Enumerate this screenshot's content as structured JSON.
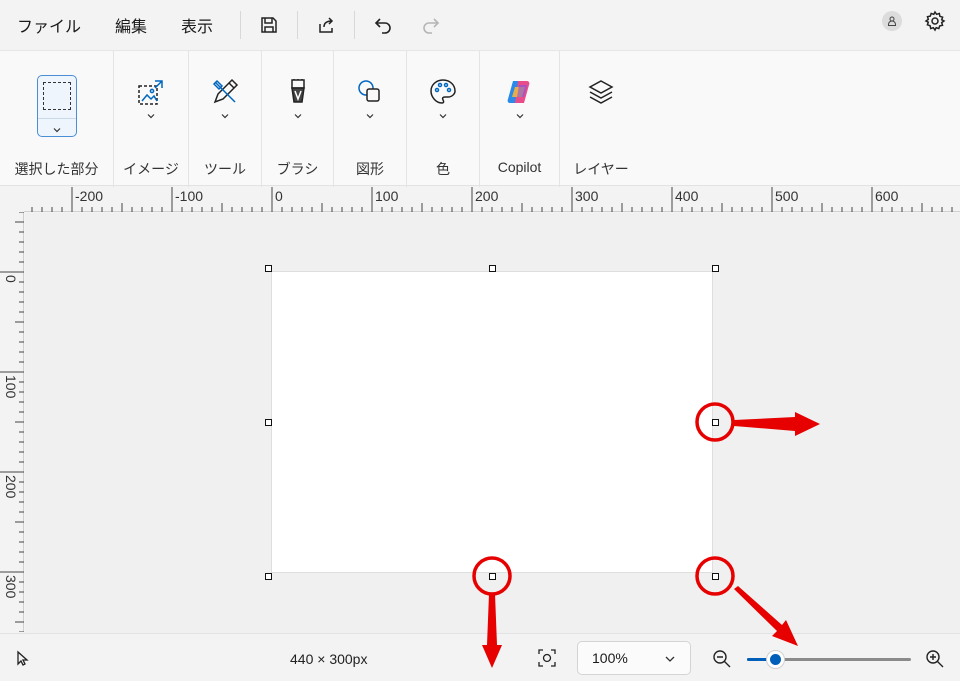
{
  "menu": {
    "file": "ファイル",
    "edit": "編集",
    "view": "表示"
  },
  "toolbar": {
    "save": "save-icon",
    "share": "share-icon",
    "undo": "undo-icon",
    "redo": "redo-icon"
  },
  "ribbon": {
    "groups": [
      {
        "label": "選択した部分",
        "icon": "selection-icon"
      },
      {
        "label": "イメージ",
        "icon": "image-icon"
      },
      {
        "label": "ツール",
        "icon": "pencil-icon"
      },
      {
        "label": "ブラシ",
        "icon": "brush-icon"
      },
      {
        "label": "図形",
        "icon": "shapes-icon"
      },
      {
        "label": "色",
        "icon": "palette-icon"
      },
      {
        "label": "Copilot",
        "icon": "copilot-icon"
      },
      {
        "label": "レイヤー",
        "icon": "layers-icon"
      }
    ]
  },
  "rulers": {
    "horizontal": [
      "-200",
      "-100",
      "0",
      "100",
      "200",
      "300",
      "400",
      "500",
      "600"
    ],
    "vertical": [
      "0",
      "100",
      "200",
      "300"
    ]
  },
  "status": {
    "canvas_size": "440 × 300px",
    "zoom": "100%",
    "zoom_level": 0.17
  },
  "colors": {
    "accent": "#005fb8",
    "annotation": "#e60000"
  }
}
